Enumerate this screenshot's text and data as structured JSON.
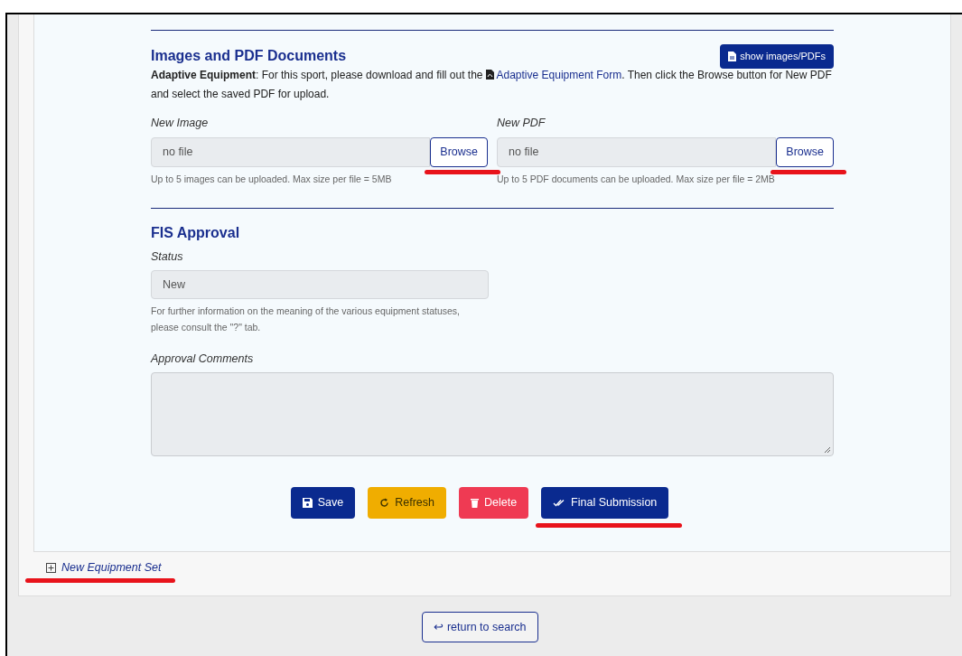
{
  "images_section": {
    "title": "Images and PDF Documents",
    "show_button": {
      "label": "show images/PDFs"
    },
    "notice": "**Adaptive Equipment**: For this sport, please download and fill out the",
    "notice_link": "Adaptive Equipment Form",
    "notice_end": ". Then click the Browse button for New PDF and select the saved PDF for upload.",
    "uploads": [
      {
        "label": "New Image",
        "value": "no file",
        "button": "Browse",
        "highlighted": true,
        "help": "Up to 5 images can be uploaded. Max size per file = 5MB"
      },
      {
        "label": "New PDF",
        "value": "no file",
        "button": "Browse",
        "highlighted": true,
        "help": "Up to 5 PDF documents can be uploaded. Max size per file = 2MB"
      }
    ]
  },
  "approval_section": {
    "title": "FIS Approval",
    "status_label": "Status",
    "status_value": "New",
    "status_help": "For further information on the meaning of the various equipment statuses, please consult the \"?\" tab.",
    "comments_label": "Approval Comments"
  },
  "actions": [
    {
      "kind": "save",
      "label": "Save",
      "highlighted": false
    },
    {
      "kind": "refresh",
      "label": "Refresh",
      "highlighted": false
    },
    {
      "kind": "delete",
      "label": "Delete",
      "highlighted": false
    },
    {
      "kind": "submit",
      "label": "Final Submission",
      "highlighted": true
    }
  ],
  "new_set": {
    "label": "New Equipment Set",
    "highlighted": true
  },
  "return_button": {
    "label": "return to search",
    "icon": "↩"
  }
}
